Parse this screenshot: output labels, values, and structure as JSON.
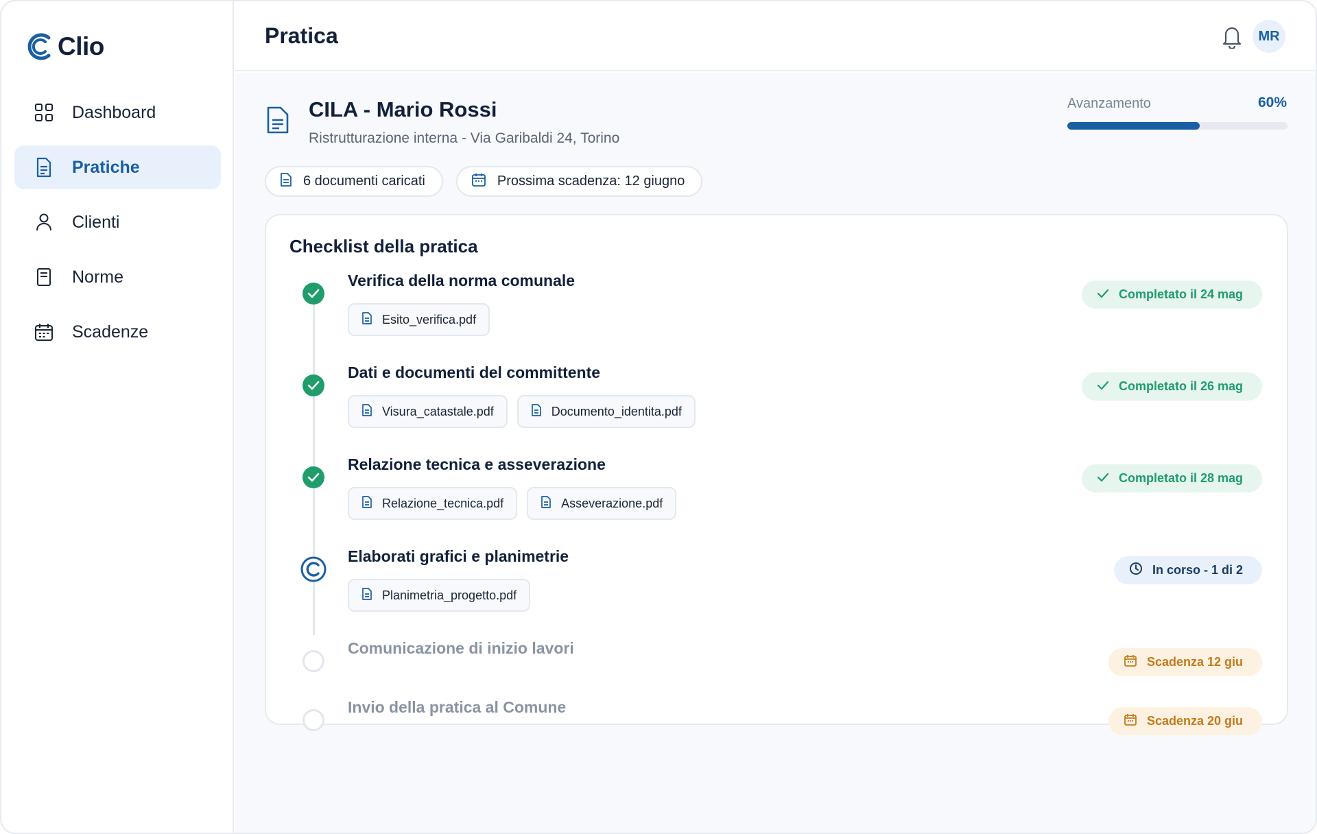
{
  "app": {
    "name": "Clio"
  },
  "sidebar": {
    "items": [
      {
        "label": "Dashboard",
        "icon": "grid-icon",
        "active": false
      },
      {
        "label": "Pratiche",
        "icon": "document-icon",
        "active": true
      },
      {
        "label": "Clienti",
        "icon": "user-icon",
        "active": false
      },
      {
        "label": "Norme",
        "icon": "book-icon",
        "active": false
      },
      {
        "label": "Scadenze",
        "icon": "calendar-icon",
        "active": false
      }
    ]
  },
  "header": {
    "title": "Pratica",
    "avatar_initials": "MR"
  },
  "practice": {
    "title": "CILA - Mario Rossi",
    "subtitle": "Ristrutturazione interna - Via Garibaldi 24, Torino",
    "progress_label": "Avanzamento",
    "progress_value": "60%",
    "progress_fraction": 0.6,
    "chips": {
      "documents": "6 documenti caricati",
      "deadline": "Prossima scadenza: 12 giugno"
    }
  },
  "checklist": {
    "title": "Checklist della pratica",
    "steps": [
      {
        "title": "Verifica della norma comunale",
        "state": "done",
        "status": "Completato il 24 mag",
        "files": [
          "Esito_verifica.pdf"
        ]
      },
      {
        "title": "Dati e documenti del committente",
        "state": "done",
        "status": "Completato il 26 mag",
        "files": [
          "Visura_catastale.pdf",
          "Documento_identita.pdf"
        ]
      },
      {
        "title": "Relazione tecnica e asseverazione",
        "state": "done",
        "status": "Completato il 28 mag",
        "files": [
          "Relazione_tecnica.pdf",
          "Asseverazione.pdf"
        ]
      },
      {
        "title": "Elaborati grafici e planimetrie",
        "state": "current",
        "status": "In corso - 1 di 2",
        "files": [
          "Planimetria_progetto.pdf"
        ]
      },
      {
        "title": "Comunicazione di inizio lavori",
        "state": "todo",
        "status": "Scadenza 12 giu",
        "files": []
      },
      {
        "title": "Invio della pratica al Comune",
        "state": "todo",
        "status": "Scadenza 20 giu",
        "files": []
      }
    ]
  },
  "colors": {
    "accent": "#1a5fa3",
    "success": "#1f9d6b",
    "warning": "#c47a1b",
    "text": "#12203a"
  }
}
